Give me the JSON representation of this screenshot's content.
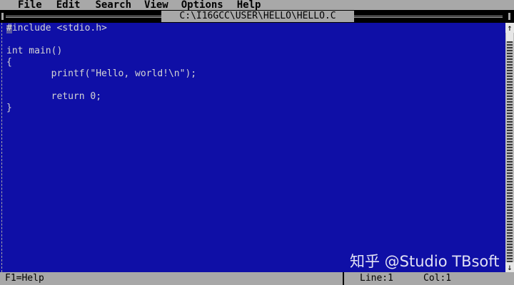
{
  "menu": {
    "items": [
      {
        "label": "File"
      },
      {
        "label": "Edit"
      },
      {
        "label": "Search"
      },
      {
        "label": "View"
      },
      {
        "label": "Options"
      },
      {
        "label": "Help"
      }
    ]
  },
  "window": {
    "title": "C:\\I16GCC\\USER\\HELLO\\HELLO.C"
  },
  "editor": {
    "lines": [
      "#include <stdio.h>",
      "",
      "int main()",
      "{",
      "        printf(\"Hello, world!\\n\");",
      "",
      "        return 0;",
      "}"
    ]
  },
  "scrollbar": {
    "up_arrow": "↑",
    "down_arrow": "↓"
  },
  "status": {
    "help": "F1=Help",
    "line": "Line:1",
    "col": "Col:1"
  },
  "watermark": {
    "text": "知乎 @Studio TBsoft"
  },
  "colors": {
    "editor_background": "#0f0fa6",
    "editor_text": "#d4d4d4",
    "bar_gray": "#a8a8a8",
    "title_bar_black": "#000000"
  }
}
